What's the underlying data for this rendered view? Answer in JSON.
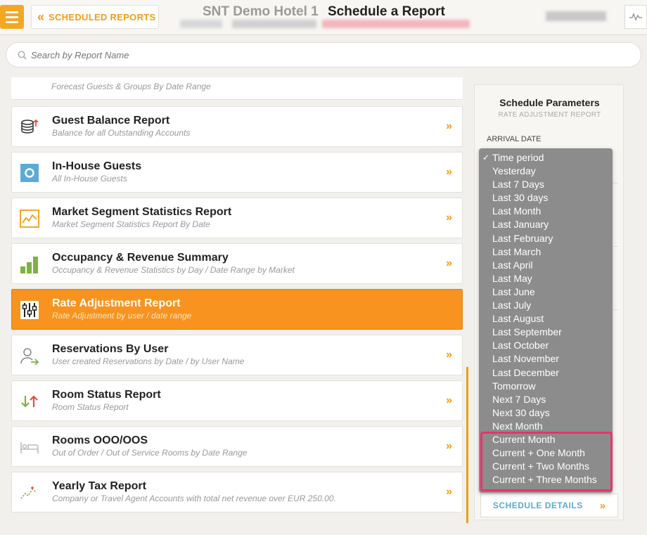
{
  "header": {
    "back_label": "SCHEDULED REPORTS",
    "hotel_name": "SNT Demo Hotel 1",
    "page_title": "Schedule a Report"
  },
  "search": {
    "placeholder": "Search by Report Name"
  },
  "reports": {
    "partial_desc": "Forecast Guests & Groups By Date Range",
    "items": [
      {
        "name": "Guest Balance Report",
        "desc": "Balance for all Outstanding Accounts",
        "icon": "coins-icon"
      },
      {
        "name": "In-House Guests",
        "desc": "All In-House Guests",
        "icon": "in-house-icon"
      },
      {
        "name": "Market Segment Statistics Report",
        "desc": "Market Segment Statistics Report By Date",
        "icon": "line-chart-icon"
      },
      {
        "name": "Occupancy & Revenue Summary",
        "desc": "Occupancy & Revenue Statistics by Day / Date Range by Market",
        "icon": "bar-chart-icon"
      },
      {
        "name": "Rate Adjustment Report",
        "desc": "Rate Adjustment by user / date range",
        "icon": "sliders-icon"
      },
      {
        "name": "Reservations By User",
        "desc": "User created Reservations by Date / by User Name",
        "icon": "user-arrow-icon"
      },
      {
        "name": "Room Status Report",
        "desc": "Room Status Report",
        "icon": "up-down-arrows-icon"
      },
      {
        "name": "Rooms OOO/OOS",
        "desc": "Out of Order / Out of Service Rooms by Date Range",
        "icon": "bed-icon"
      },
      {
        "name": "Yearly Tax Report",
        "desc": "Company or Travel Agent Accounts with total net revenue over EUR 250.00.",
        "icon": "trend-icon"
      }
    ],
    "chevron": "»"
  },
  "panel": {
    "title": "Schedule Parameters",
    "subtitle": "RATE ADJUSTMENT REPORT",
    "arrival_label": "ARRIVAL DATE",
    "schedule_button": "SCHEDULE DETAILS",
    "schedule_chevron": "»"
  },
  "dropdown": {
    "selected": "Time period",
    "checkmark": "✓",
    "options": [
      "Time period",
      "Yesterday",
      "Last 7 Days",
      "Last 30 days",
      "Last Month",
      "Last January",
      "Last February",
      "Last March",
      "Last April",
      "Last May",
      "Last June",
      "Last July",
      "Last August",
      "Last September",
      "Last October",
      "Last November",
      "Last December",
      "Tomorrow",
      "Next 7 Days",
      "Next 30 days",
      "Next Month",
      "Current Month",
      "Current + One Month",
      "Current + Two Months",
      "Current + Three Months"
    ]
  },
  "colors": {
    "accent": "#f39c12",
    "active_row": "#f7931e",
    "highlight": "#e8336b",
    "link_blue": "#5aa9d6"
  }
}
